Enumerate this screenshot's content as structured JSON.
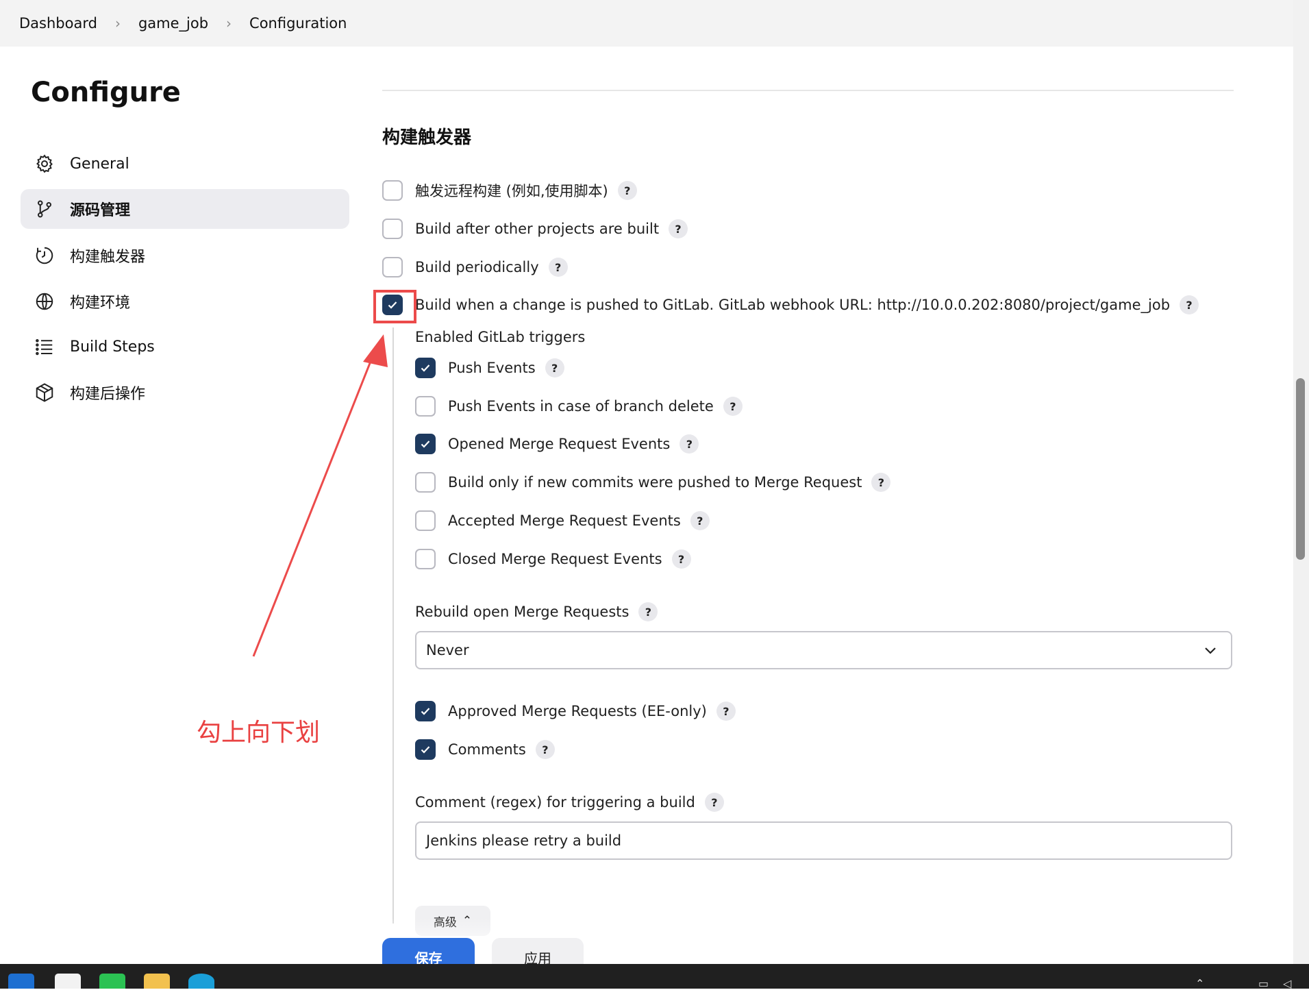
{
  "breadcrumb": {
    "items": [
      "Dashboard",
      "game_job",
      "Configuration"
    ]
  },
  "sidebar": {
    "title": "Configure",
    "items": [
      {
        "label": "General",
        "icon": "gear-icon",
        "active": false
      },
      {
        "label": "源码管理",
        "icon": "branch-icon",
        "active": true
      },
      {
        "label": "构建触发器",
        "icon": "timer-icon",
        "active": false
      },
      {
        "label": "构建环境",
        "icon": "globe-icon",
        "active": false
      },
      {
        "label": "Build Steps",
        "icon": "list-icon",
        "active": false
      },
      {
        "label": "构建后操作",
        "icon": "package-icon",
        "active": false
      }
    ]
  },
  "main": {
    "section_title": "构建触发器",
    "triggers": [
      {
        "label": "触发远程构建 (例如,使用脚本)",
        "checked": false
      },
      {
        "label": "Build after other projects are built",
        "checked": false
      },
      {
        "label": "Build periodically",
        "checked": false
      },
      {
        "label": "Build when a change is pushed to GitLab. GitLab webhook URL: http://10.0.0.202:8080/project/game_job",
        "checked": true
      }
    ],
    "gitlab": {
      "enabled_label": "Enabled GitLab triggers",
      "events": [
        {
          "label": "Push Events",
          "checked": true
        },
        {
          "label": "Push Events in case of branch delete",
          "checked": false
        },
        {
          "label": "Opened Merge Request Events",
          "checked": true
        },
        {
          "label": "Build only if new commits were pushed to Merge Request",
          "checked": false
        },
        {
          "label": "Accepted Merge Request Events",
          "checked": false
        },
        {
          "label": "Closed Merge Request Events",
          "checked": false
        }
      ],
      "rebuild_label": "Rebuild open Merge Requests",
      "rebuild_value": "Never",
      "extra": [
        {
          "label": "Approved Merge Requests (EE-only)",
          "checked": true
        },
        {
          "label": "Comments",
          "checked": true
        }
      ],
      "comment_label": "Comment (regex) for triggering a build",
      "comment_value": "Jenkins please retry a build",
      "advanced_label": "高级"
    },
    "help_mark": "?"
  },
  "buttons": {
    "save": "保存",
    "apply": "应用"
  },
  "annotation": {
    "text": "勾上向下划",
    "color": "#e94141"
  },
  "colors": {
    "checkbox_checked": "#1e3a5f",
    "primary_button": "#2f6fde",
    "breadcrumb_bg": "#f3f3f3"
  }
}
